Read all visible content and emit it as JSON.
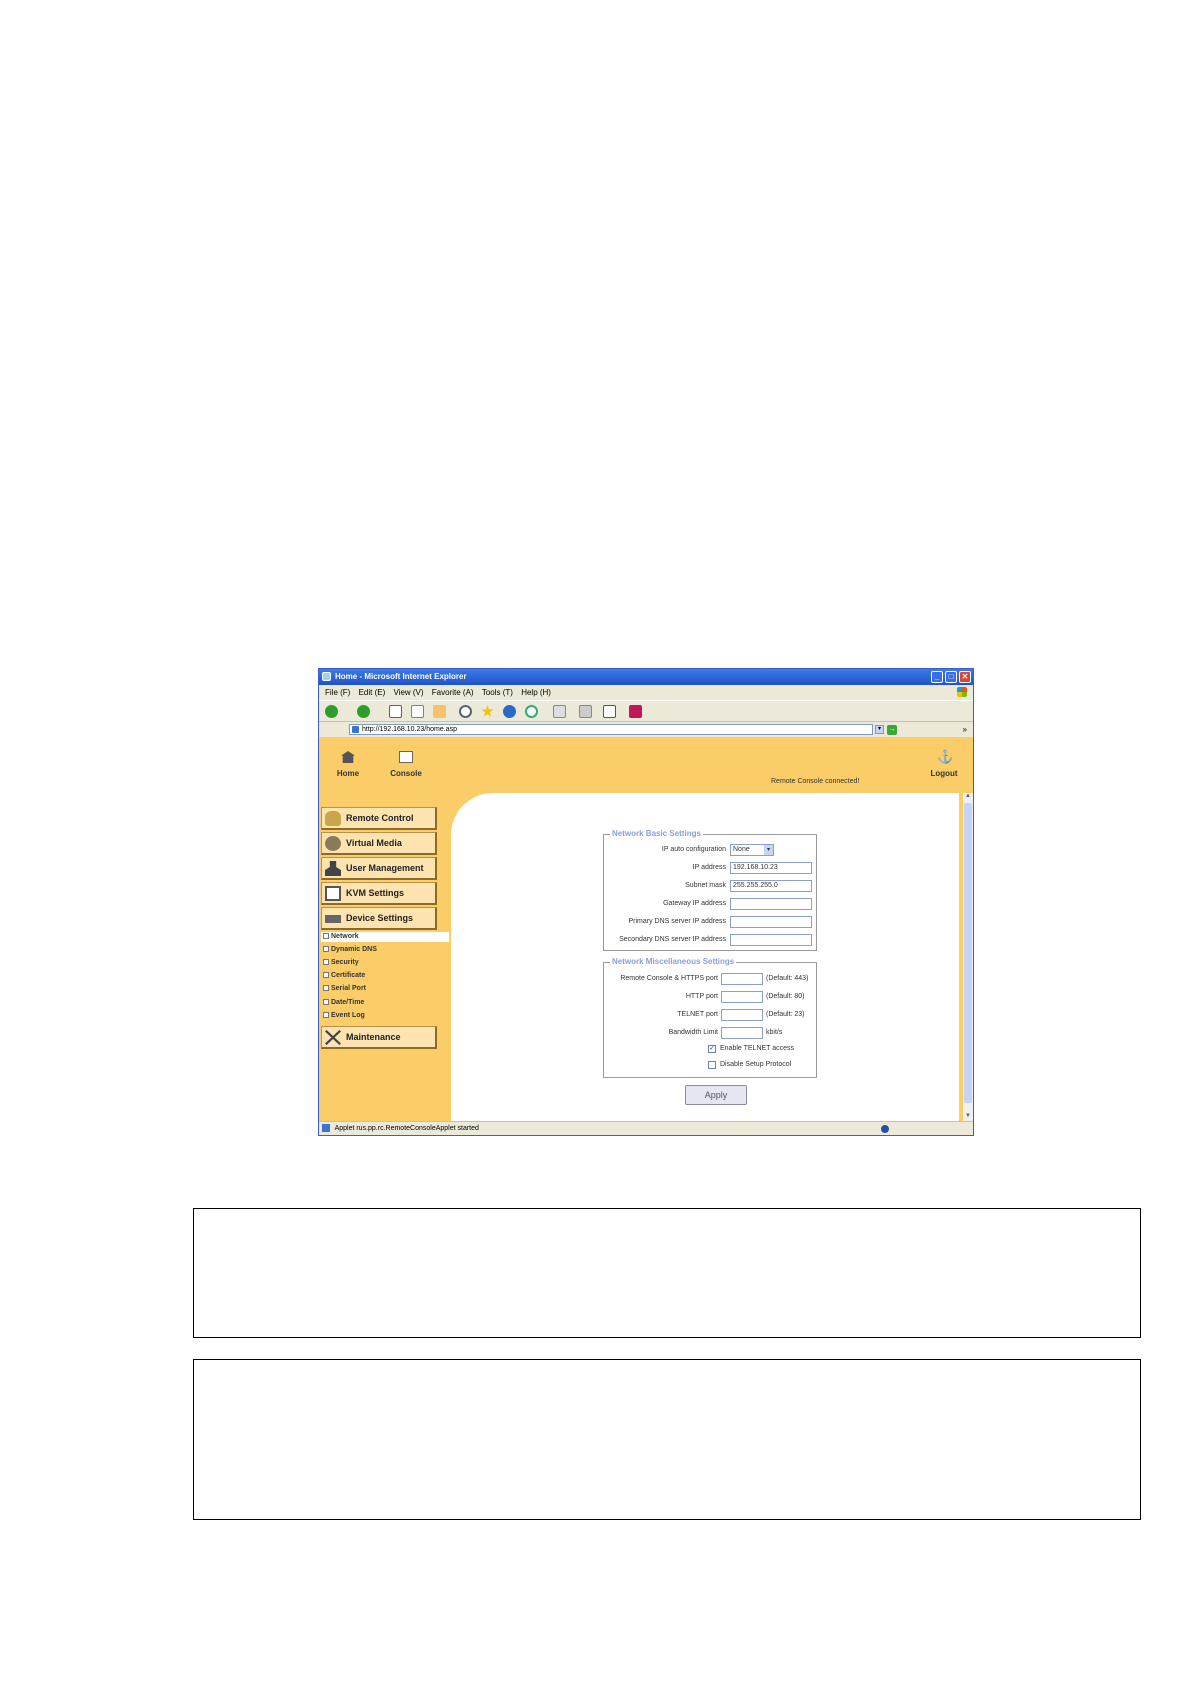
{
  "window": {
    "title": "Home - Microsoft Internet Explorer",
    "buttons": {
      "minimize": "_",
      "maximize": "□",
      "close": "✕"
    }
  },
  "menubar": {
    "items": [
      "File (F)",
      "Edit (E)",
      "View (V)",
      "Favorite (A)",
      "Tools (T)",
      "Help (H)"
    ]
  },
  "toolbar": {
    "icons": [
      "back-icon",
      "forward-icon",
      "stop-icon",
      "refresh-icon",
      "home-icon",
      "search-icon",
      "favorites-icon",
      "media-icon",
      "history-icon",
      "mail-icon",
      "print-icon",
      "edit-icon",
      "messenger-icon"
    ]
  },
  "address": {
    "label": "",
    "url": "http://192.168.10.23/home.asp",
    "go": "→",
    "more": "»"
  },
  "header": {
    "home_label": "Home",
    "console_label": "Console",
    "logout_label": "Logout",
    "status": "Remote Console connected!"
  },
  "sidebar": {
    "menus": [
      {
        "label": "Remote Control",
        "icon": "remote-control-icon"
      },
      {
        "label": "Virtual Media",
        "icon": "virtual-media-icon"
      },
      {
        "label": "User Management",
        "icon": "user-management-icon"
      },
      {
        "label": "KVM Settings",
        "icon": "kvm-settings-icon"
      },
      {
        "label": "Device Settings",
        "icon": "device-settings-icon"
      }
    ],
    "sub_items": [
      "Network",
      "Dynamic DNS",
      "Security",
      "Certificate",
      "Serial Port",
      "Date/Time",
      "Event Log"
    ],
    "active_sub": "Network",
    "maintenance": {
      "label": "Maintenance",
      "icon": "maintenance-icon"
    }
  },
  "basic": {
    "legend": "Network Basic Settings",
    "ip_auto_label": "IP auto configuration",
    "ip_auto_value": "None",
    "ip_label": "IP address",
    "ip_value": "192.168.10.23",
    "mask_label": "Subnet mask",
    "mask_value": "255.255.255.0",
    "gateway_label": "Gateway IP address",
    "gateway_value": "",
    "dns1_label": "Primary DNS server IP address",
    "dns1_value": "",
    "dns2_label": "Secondary DNS server IP address",
    "dns2_value": ""
  },
  "misc": {
    "legend": "Network Miscellaneous Settings",
    "https_label": "Remote Console & HTTPS port",
    "https_value": "",
    "https_default": "(Default: 443)",
    "http_label": "HTTP port",
    "http_value": "",
    "http_default": "(Default: 80)",
    "telnet_label": "TELNET port",
    "telnet_value": "",
    "telnet_default": "(Default: 23)",
    "bw_label": "Bandwidth Limit",
    "bw_value": "",
    "bw_unit": "kbit/s",
    "enable_telnet_label": "Enable TELNET access",
    "enable_telnet_checked": true,
    "disable_setup_label": "Disable Setup Protocol",
    "disable_setup_checked": false
  },
  "apply_label": "Apply",
  "statusbar": {
    "text": "Applet rus.pp.rc.RemoteConsoleApplet started"
  },
  "colors": {
    "page_bg": "#fbcd68",
    "menu_bg": "#fde3b0",
    "legend": "#8aa0d6",
    "titlebar": "#1f53c9"
  }
}
